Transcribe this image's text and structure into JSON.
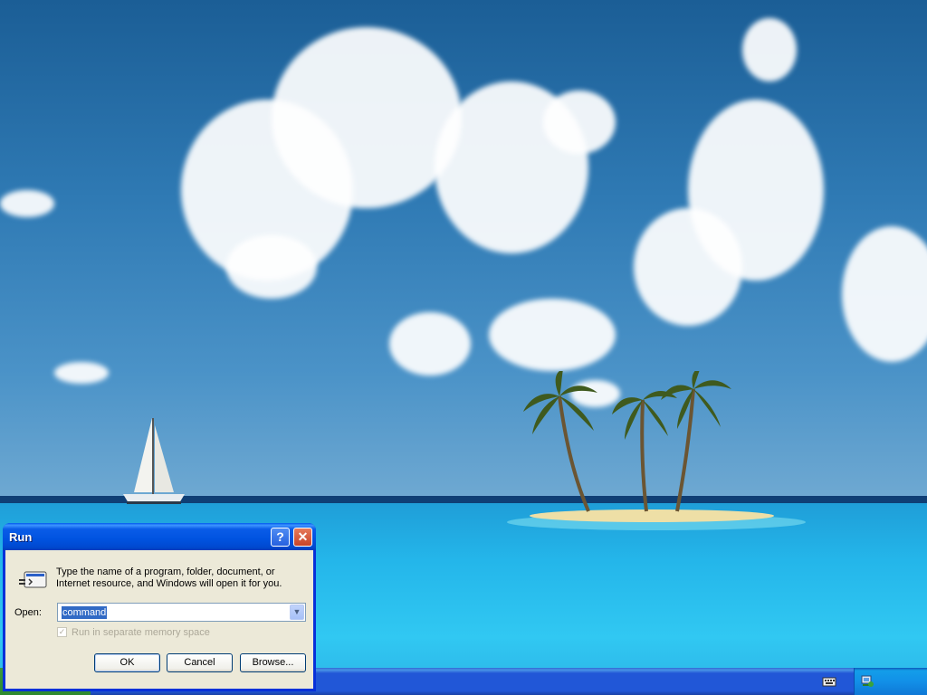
{
  "dialog": {
    "title": "Run",
    "help_button": "?",
    "close_button": "✕",
    "instructions": "Type the name of a program, folder, document, or Internet resource, and Windows will open it for you.",
    "open_label": "Open:",
    "open_value": "command",
    "checkbox": {
      "label": "Run in separate memory space",
      "checked": true,
      "enabled": false
    },
    "ok_label": "OK",
    "cancel_label": "Cancel",
    "browse_label": "Browse..."
  },
  "colors": {
    "title_bar": "#0053e0",
    "dialog_body": "#ece9d8",
    "taskbar": "#2157d7",
    "selection": "#316ac5"
  },
  "tray": {
    "icons": [
      "keyboard-icon",
      "network-icon"
    ]
  }
}
